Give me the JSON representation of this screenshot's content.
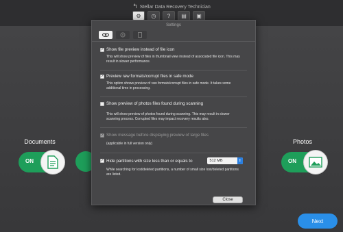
{
  "app": {
    "title": "Stellar Data Recovery Technician",
    "toolbar_icons": [
      "gear-icon",
      "clock-icon",
      "help-icon",
      "cart-icon",
      "user-icon"
    ]
  },
  "categories": [
    {
      "label": "Documents",
      "toggle": "ON",
      "icon": "document-icon"
    },
    {
      "label": "",
      "toggle": "",
      "icon": "partial-toggle"
    },
    {
      "label": "Photos",
      "toggle": "ON",
      "icon": "photo-icon"
    }
  ],
  "next_label": "Next",
  "dialog": {
    "title": "Settings",
    "tabs": [
      "eye-icon",
      "gear-icon",
      "file-icon"
    ],
    "options": [
      {
        "label": "Show file preview instead of file icon",
        "checked": true,
        "desc": "This will show preview of files in thumbnail view instead of associated file icon. This may result in slower performance."
      },
      {
        "label": "Preview raw formats/corrupt files in safe mode",
        "checked": true,
        "desc": "This option shows preview of raw formats/corrupt files in safe mode. It takes some additional time in processing."
      },
      {
        "label": "Show preview of photos files found during scanning",
        "checked": false,
        "desc": "This will show preview of photos found during scanning. This may result in slower scanning process. Corrupted files may impact recovery results also."
      },
      {
        "label": "Show message before displaying preview of large files",
        "checked": true,
        "disabled": true,
        "desc": "(applicable in full version only)"
      },
      {
        "label": "Hide partitions with size less than or equals to",
        "checked": true,
        "desc": "While searching for lost/deleted partitions, a number of small size lost/deleted partitions are listed."
      }
    ],
    "size_value": "512 MB",
    "close_label": "Close"
  }
}
